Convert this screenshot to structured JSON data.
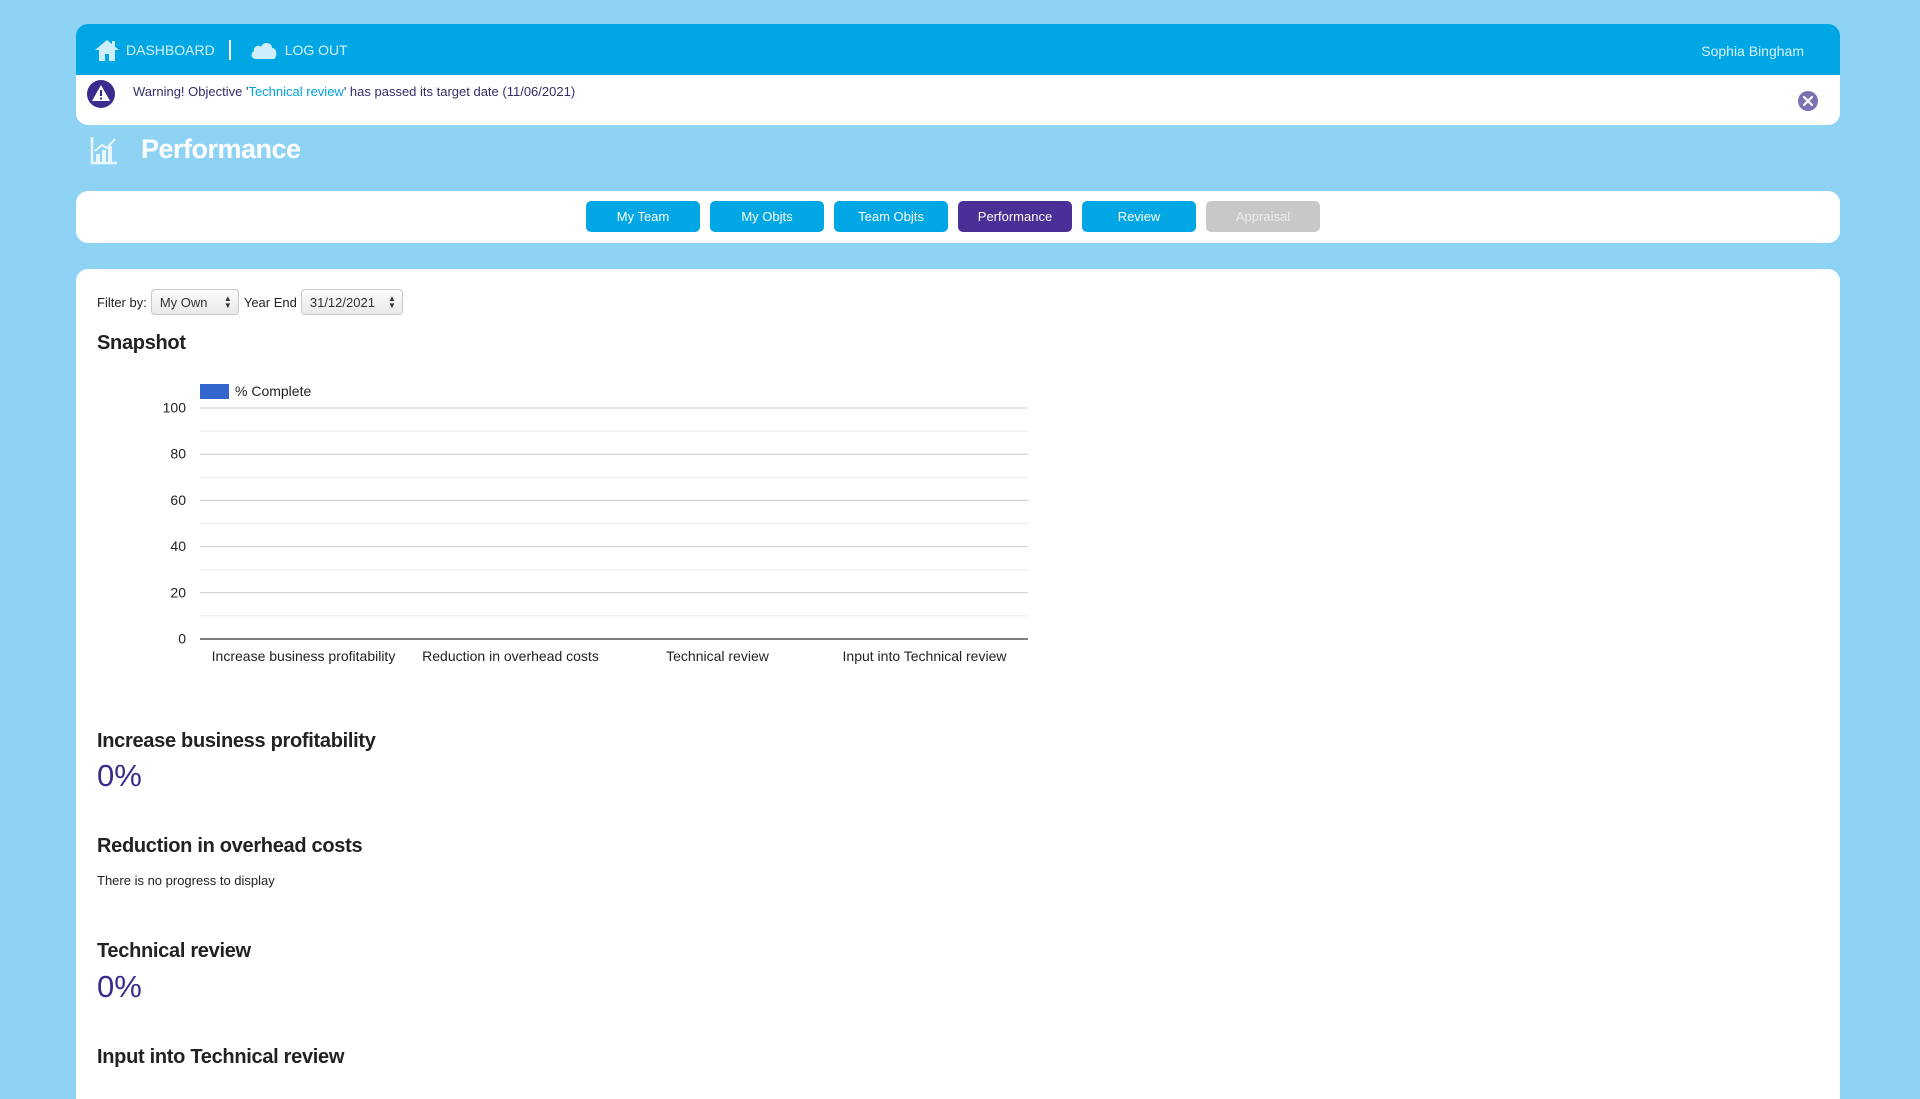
{
  "nav": {
    "dashboard_label": "DASHBOARD",
    "logout_label": "LOG OUT",
    "user_name": "Sophia Bingham"
  },
  "alert": {
    "prefix": "Warning! Objective '",
    "objective": "Technical review",
    "suffix": "' has passed its target date (11/06/2021)"
  },
  "page": {
    "title": "Performance"
  },
  "tabs": [
    {
      "label": "My Team",
      "state": "normal"
    },
    {
      "label": "My Objts",
      "state": "normal"
    },
    {
      "label": "Team Objts",
      "state": "normal"
    },
    {
      "label": "Performance",
      "state": "active"
    },
    {
      "label": "Review",
      "state": "normal"
    },
    {
      "label": "Appraisal",
      "state": "disabled"
    }
  ],
  "filter": {
    "label": "Filter by:",
    "value": "My Own",
    "year_label": "Year End",
    "year_value": "31/12/2021"
  },
  "snapshot": {
    "title": "Snapshot"
  },
  "chart_data": {
    "type": "bar",
    "categories": [
      "Increase business profitability",
      "Reduction in overhead costs",
      "Technical review",
      "Input into Technical review"
    ],
    "series": [
      {
        "name": "% Complete",
        "values": [
          0,
          0,
          0,
          0
        ],
        "color": "#3366cc"
      }
    ],
    "ylim": [
      0,
      100
    ],
    "yticks": [
      0,
      20,
      40,
      60,
      80,
      100
    ],
    "legend": "top-left",
    "grid": true
  },
  "objectives": [
    {
      "title": "Increase business profitability",
      "progress": "0%"
    },
    {
      "title": "Reduction in overhead costs",
      "message": "There is no progress to display"
    },
    {
      "title": "Technical review",
      "progress": "0%"
    },
    {
      "title": "Input into Technical review"
    }
  ],
  "colors": {
    "background": "#8fd3f4",
    "brand": "#00a7e4",
    "active_tab": "#4b2e96",
    "progress_text": "#3a2c8c"
  }
}
